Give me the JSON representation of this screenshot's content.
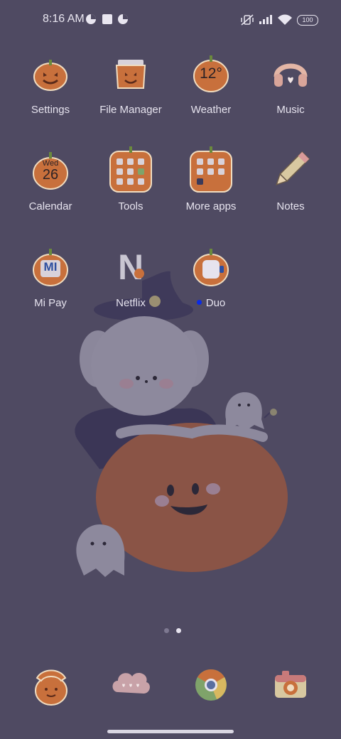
{
  "status_bar": {
    "time": "8:16 AM",
    "battery": "100",
    "icons": [
      "pie-notification-icon",
      "square-notification-icon",
      "pie-notification-icon",
      "vibrate-off-icon",
      "signal-icon",
      "wifi-icon",
      "battery-icon"
    ]
  },
  "apps": {
    "row1": [
      {
        "label": "Settings",
        "icon": "pumpkin-settings-icon"
      },
      {
        "label": "File Manager",
        "icon": "pumpkin-bag-icon"
      },
      {
        "label": "Weather",
        "icon": "pumpkin-weather-icon",
        "badge": "12°"
      },
      {
        "label": "Music",
        "icon": "headphones-icon"
      }
    ],
    "row2": [
      {
        "label": "Calendar",
        "icon": "pumpkin-calendar-icon",
        "day": "Wed",
        "date": "26"
      },
      {
        "label": "Tools",
        "icon": "folder-icon"
      },
      {
        "label": "More apps",
        "icon": "folder-icon"
      },
      {
        "label": "Notes",
        "icon": "pencil-icon"
      }
    ],
    "row3": [
      {
        "label": "Mi Pay",
        "icon": "pumpkin-mipay-icon",
        "badge": "MI"
      },
      {
        "label": "Netflix",
        "icon": "netflix-n-icon",
        "badge": "N"
      },
      {
        "label": "Duo",
        "icon": "pumpkin-duo-icon",
        "new_indicator": true
      }
    ]
  },
  "dock": [
    "phone-icon",
    "messages-cloud-icon",
    "chrome-icon",
    "camera-icon"
  ],
  "pages": {
    "count": 2,
    "current": 2
  },
  "colors": {
    "background": "#4f4a62",
    "pumpkin": "#c8703c",
    "label": "#e6e3ee",
    "new_dot": "#0a2be6"
  }
}
